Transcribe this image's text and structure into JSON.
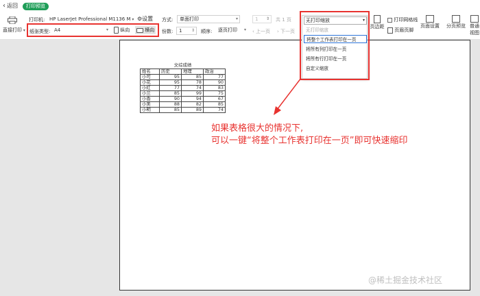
{
  "topbar": {
    "back_label": "返回",
    "tab_label": "打印预览"
  },
  "toolbar": {
    "direct_print_label": "直接打印",
    "printer_label": "打印机:",
    "printer_value": "HP LaserJet Professional M1136 M",
    "settings_label": "设置",
    "mode_label": "方式:",
    "mode_value": "单面打印",
    "page_value": "1",
    "total_pages": "共 1 页",
    "paper_type_label": "纸张类型:",
    "paper_type_value": "A4",
    "portrait_label": "纵向",
    "landscape_label": "横向",
    "copies_label": "份数:",
    "copies_value": "1",
    "order_label": "顺序:",
    "order_value": "逐页打印",
    "prev_page_label": "上一页",
    "next_page_label": "下一页",
    "print_gridlines_label": "打印网格线",
    "margins_label": "页边距",
    "header_footer_label": "页眉页脚",
    "page_setup_label": "页面设置",
    "page_preview_label": "分页预览",
    "normal_view_label": "普通视图"
  },
  "scale_dropdown": {
    "current": "无打印缩放",
    "options": [
      "无打印缩放",
      "将整个工作表打印在一页",
      "将所有列打印在一页",
      "将所有行打印在一页",
      "自定义缩放"
    ],
    "selected_index": 1
  },
  "sheet": {
    "title": "文综成绩",
    "headers": [
      "姓名",
      "历史",
      "地理",
      "政治"
    ],
    "rows": [
      [
        "小可",
        "95",
        "85",
        "77"
      ],
      [
        "小花",
        "95",
        "78",
        "90"
      ],
      [
        "小红",
        "77",
        "74",
        "83"
      ],
      [
        "小兰",
        "85",
        "99",
        "75"
      ],
      [
        "小香",
        "90",
        "94",
        "67"
      ],
      [
        "小美",
        "88",
        "82",
        "85"
      ],
      [
        "小明",
        "85",
        "89",
        "74"
      ]
    ]
  },
  "annotation": {
    "line1": "如果表格很大的情况下,",
    "line2": "可以一键“将整个工作表打印在一页”即可快速缩印"
  },
  "watermark": "@稀土掘金技术社区",
  "colors": {
    "accent_green": "#1f9e58",
    "annotation_red": "#e8322f",
    "selected_blue": "#2b73d8"
  }
}
